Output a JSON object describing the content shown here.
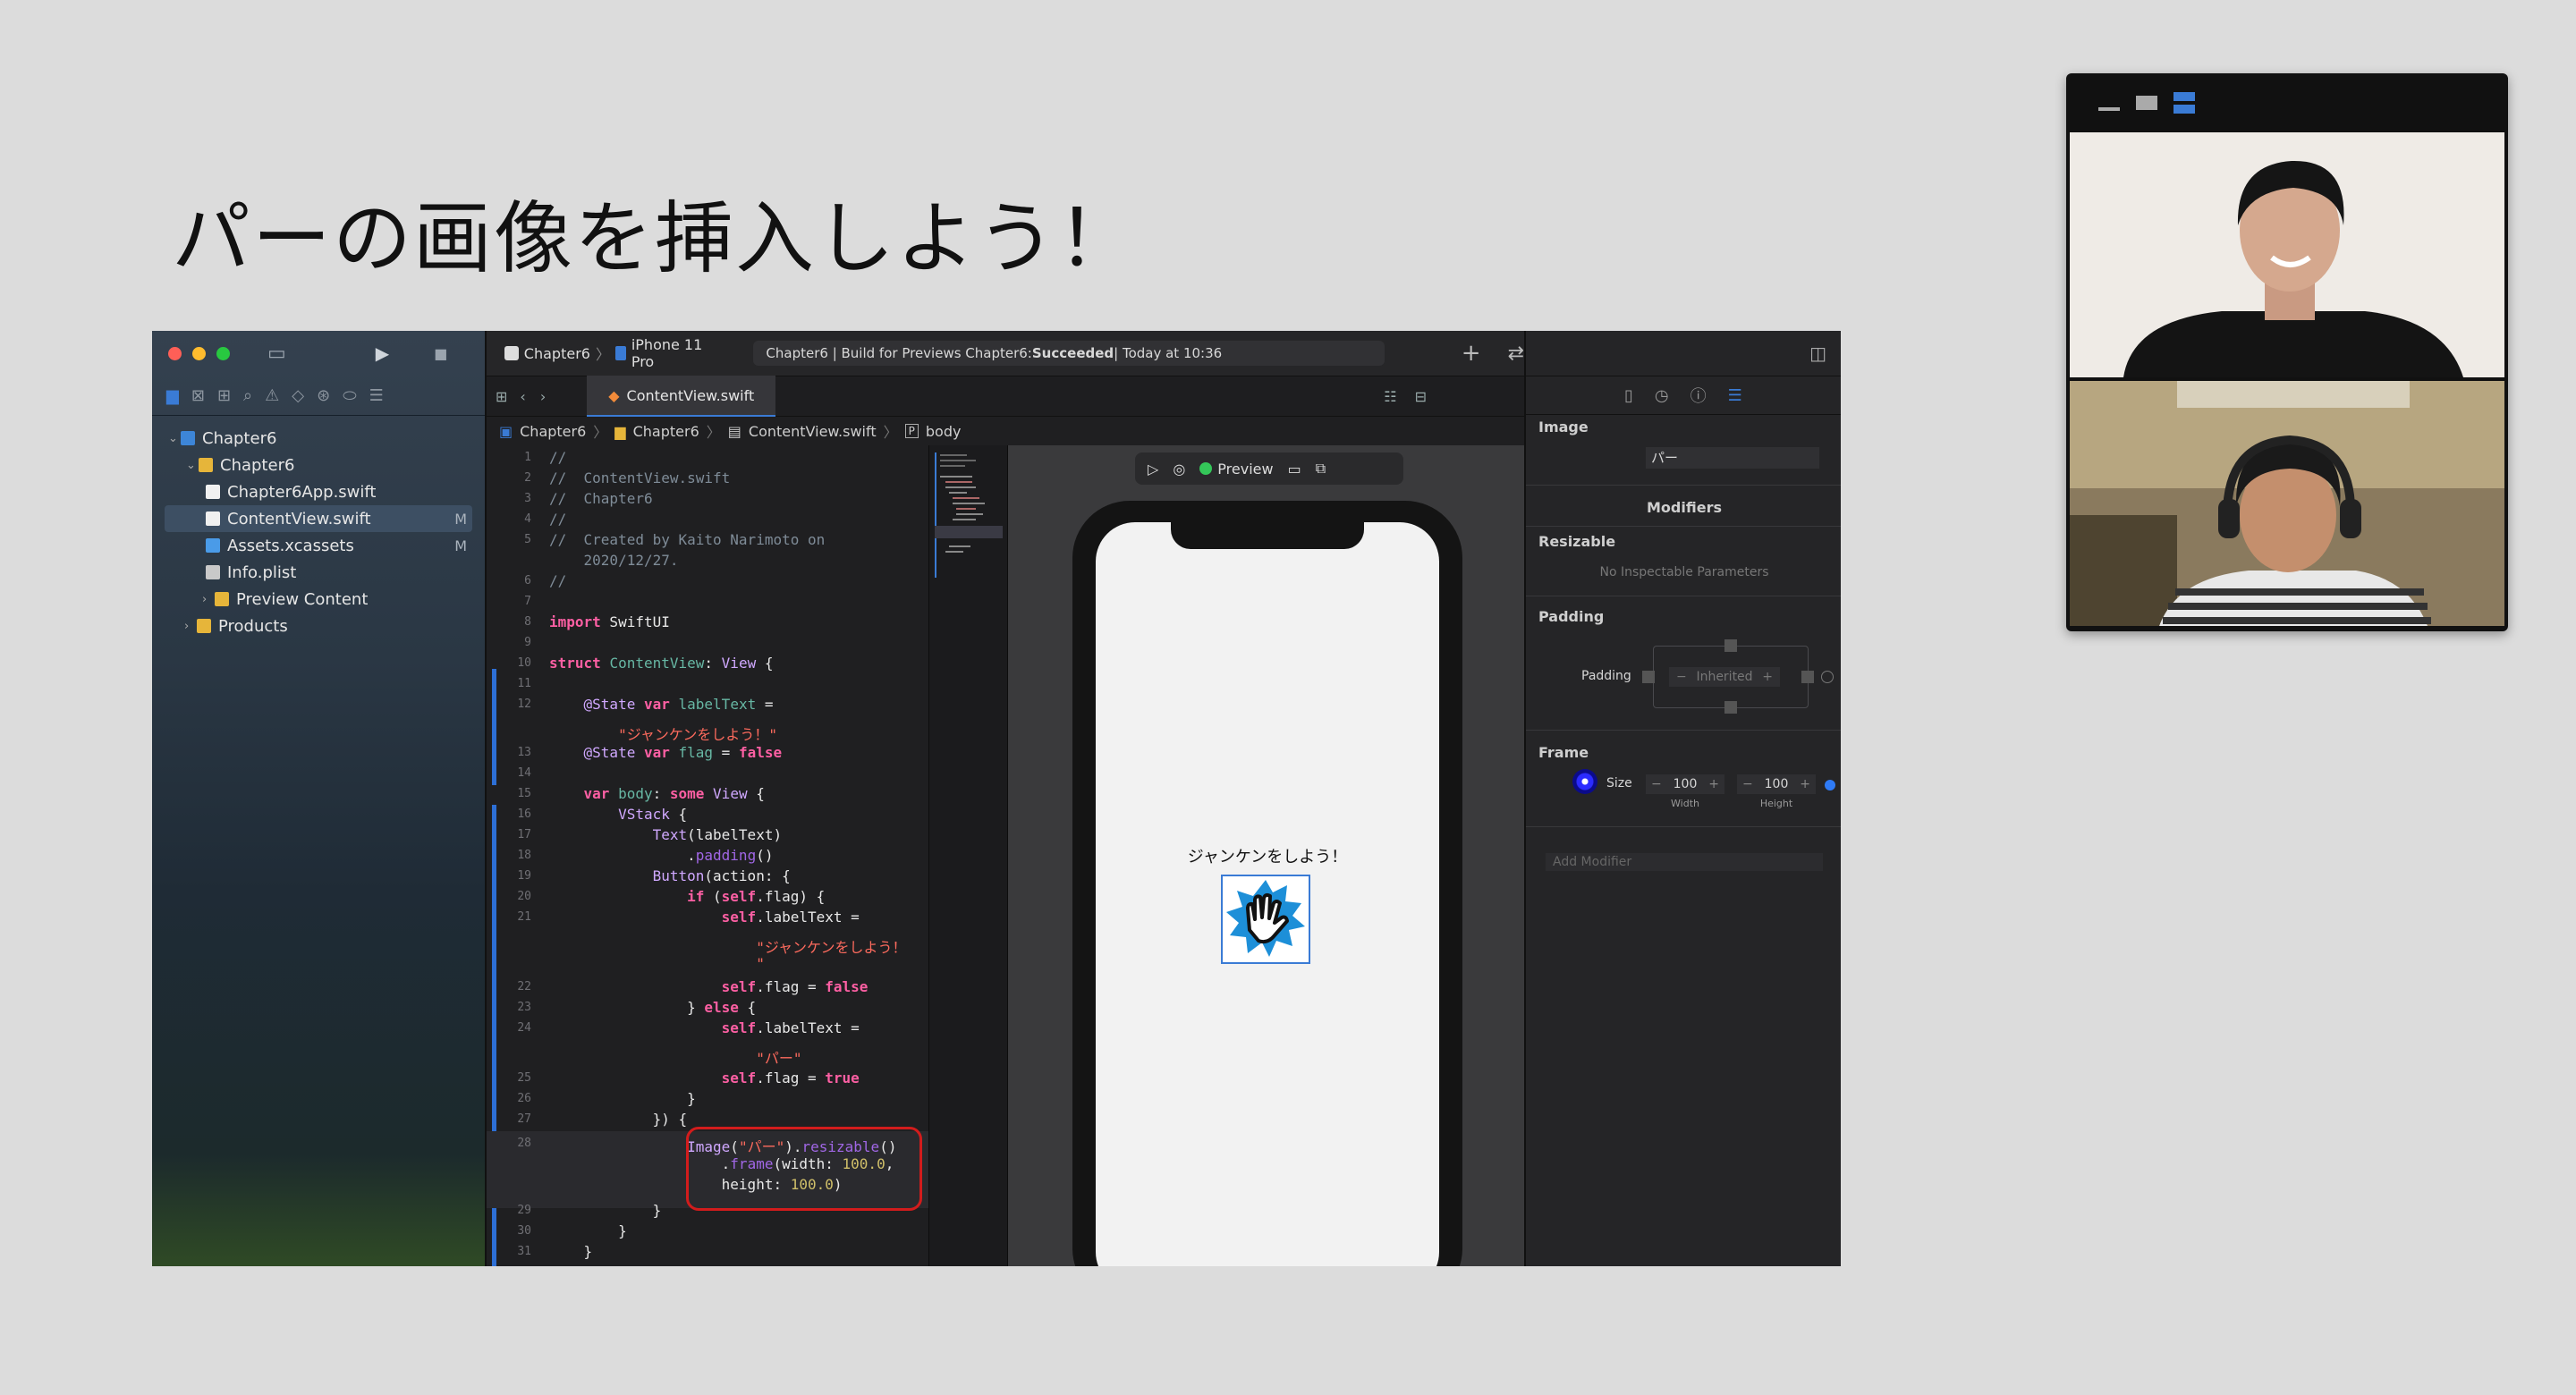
{
  "slide": {
    "title": "パーの画像を挿入しよう！"
  },
  "xcode": {
    "scheme": "Chapter6",
    "device": "iPhone 11 Pro",
    "status_prefix": "Chapter6 | Build for Previews Chapter6: ",
    "status_result": "Succeeded",
    "status_time": " | Today at 10:36",
    "tab_label": "ContentView.swift",
    "jump_bar": [
      "Chapter6",
      "Chapter6",
      "ContentView.swift",
      "body"
    ],
    "tree": [
      {
        "label": "Chapter6",
        "kind": "project",
        "depth": 0,
        "expanded": true
      },
      {
        "label": "Chapter6",
        "kind": "folder",
        "depth": 1,
        "expanded": true
      },
      {
        "label": "Chapter6App.swift",
        "kind": "swift",
        "depth": 2
      },
      {
        "label": "ContentView.swift",
        "kind": "swift",
        "depth": 2,
        "selected": true,
        "badge": "M"
      },
      {
        "label": "Assets.xcassets",
        "kind": "assets",
        "depth": 2,
        "badge": "M"
      },
      {
        "label": "Info.plist",
        "kind": "plist",
        "depth": 2
      },
      {
        "label": "Preview Content",
        "kind": "folder",
        "depth": 2,
        "expanded": false
      },
      {
        "label": "Products",
        "kind": "folder",
        "depth": 1,
        "expanded": false
      }
    ],
    "preview": {
      "label": "Preview",
      "screen_text": "ジャンケンをしよう！"
    },
    "inspector": {
      "image_label": "Image",
      "image_value": "パー",
      "modifiers_label": "Modifiers",
      "resizable_label": "Resizable",
      "no_params": "No Inspectable Parameters",
      "padding_section": "Padding",
      "padding_label": "Padding",
      "padding_value": "Inherited",
      "frame_section": "Frame",
      "size_label": "Size",
      "width_value": "100",
      "height_value": "100",
      "width_label": "Width",
      "height_label": "Height",
      "add_modifier": "Add Modifier"
    }
  },
  "colors": {
    "accent": "#3a7bd5",
    "highlight_box": "#d21c1c",
    "succeeded": "#ffffff"
  }
}
